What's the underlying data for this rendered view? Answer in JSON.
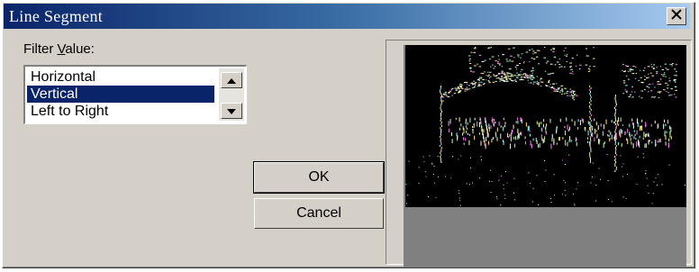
{
  "window": {
    "title": "Line Segment"
  },
  "filter": {
    "label_prefix": "Filter ",
    "label_accel": "V",
    "label_suffix": "alue:",
    "options": [
      "Horizontal",
      "Vertical",
      "Left to Right"
    ],
    "selected": "Vertical"
  },
  "buttons": {
    "ok": "OK",
    "cancel": "Cancel"
  },
  "colors": {
    "titlebar_start": "#0a246a",
    "selection": "#0a246a",
    "dialog_bg": "#d4d0c8"
  },
  "icons": {
    "close": "close-icon",
    "scroll_up": "scroll-up-arrow-icon",
    "scroll_down": "scroll-down-arrow-icon"
  }
}
